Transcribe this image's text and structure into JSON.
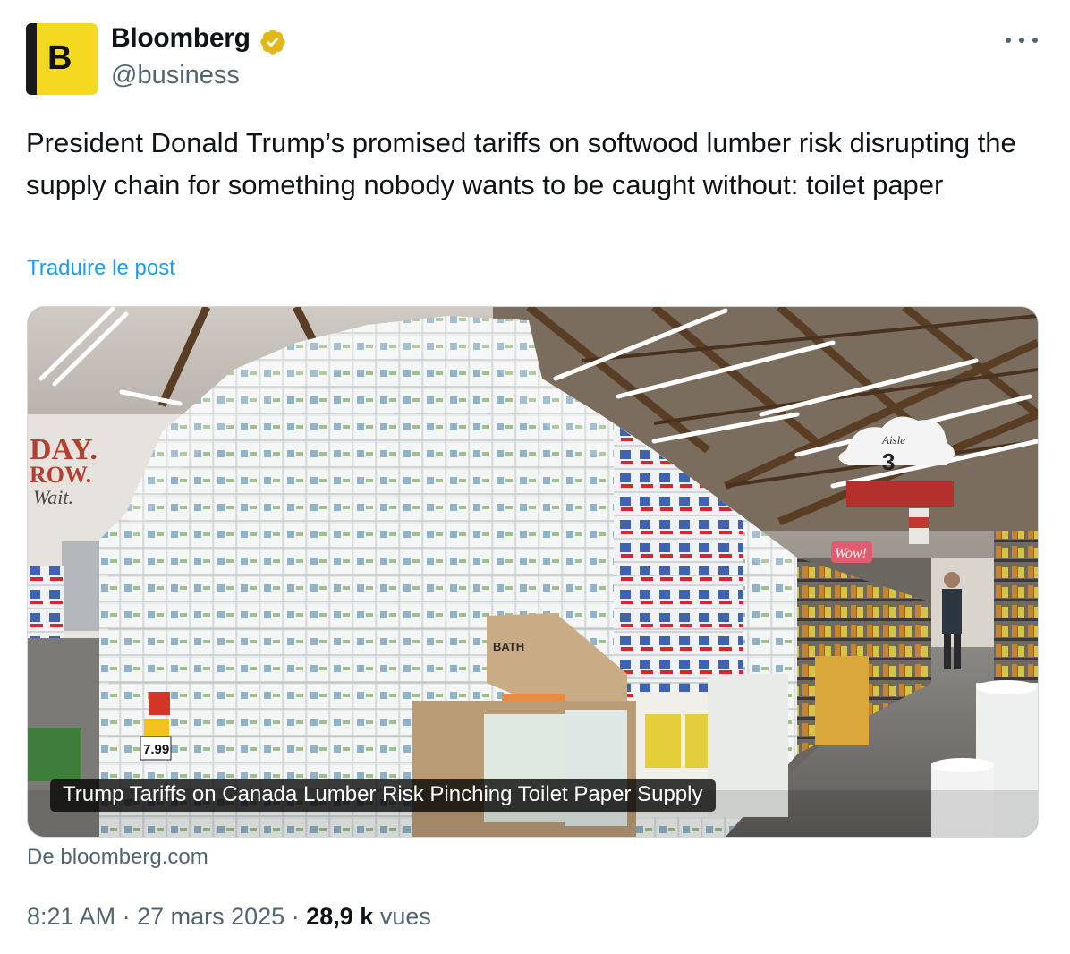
{
  "author": {
    "name": "Bloomberg",
    "handle": "@business",
    "avatar_letter": "B",
    "verified": true,
    "verified_color": "#e2b719"
  },
  "tweet": {
    "text": "President Donald Trump’s promised tariffs on softwood lumber risk disrupting the supply chain for something nobody wants to be caught without: toilet paper",
    "translate_label": "Traduire le post"
  },
  "card": {
    "title": "Trump Tariffs on Canada Lumber Risk Pinching Toilet Paper Supply",
    "source": "De bloomberg.com",
    "image_signs": {
      "aisle_word": "Aisle",
      "aisle_number": "3",
      "price": "7.99",
      "wall_text_1": "DAY.",
      "wall_text_2": "ROW.",
      "wall_text_3": "Wait.",
      "wow_sign": "Wow!"
    }
  },
  "meta": {
    "time": "8:21 AM",
    "date": "27 mars 2025",
    "separator": "·",
    "views_count": "28,9 k",
    "views_label": "vues"
  },
  "colors": {
    "link": "#1d9bf0",
    "secondary_text": "#536471",
    "avatar_bg": "#f5d820"
  }
}
